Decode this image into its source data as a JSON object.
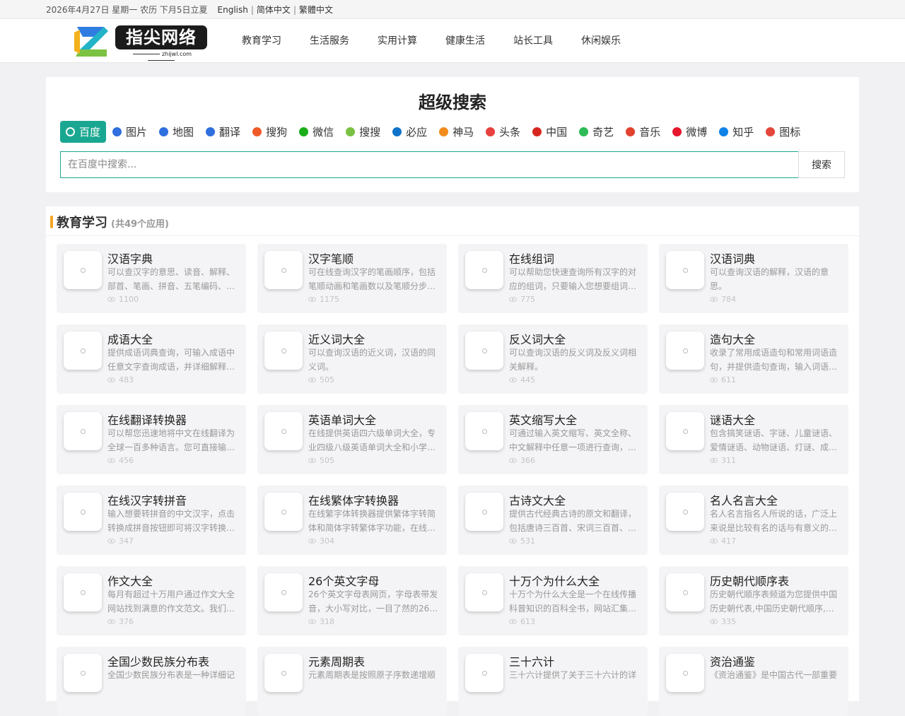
{
  "topbar": {
    "date": "2026年4月27日 星期一 农历 下月5日立夏",
    "langs": [
      "English",
      "简体中文",
      "繁體中文"
    ]
  },
  "logo": {
    "text": "指尖网络",
    "domain": "zhijwl.com"
  },
  "nav": [
    "教育学习",
    "生活服务",
    "实用计算",
    "健康生活",
    "站长工具",
    "休闲娱乐"
  ],
  "search": {
    "title": "超级搜索",
    "placeholder": "在百度中搜索...",
    "button": "搜索",
    "engines": [
      {
        "label": "百度",
        "icon": "baidu-paw-icon",
        "color": "#ffffff"
      },
      {
        "label": "图片",
        "icon": "baidu-paw-icon",
        "color": "#2f6fde"
      },
      {
        "label": "地图",
        "icon": "baidu-paw-icon",
        "color": "#2f6fde"
      },
      {
        "label": "翻译",
        "icon": "baidu-paw-icon",
        "color": "#2f6fde"
      },
      {
        "label": "搜狗",
        "icon": "sogou-icon",
        "color": "#f05a28"
      },
      {
        "label": "微信",
        "icon": "wechat-icon",
        "color": "#1aad19"
      },
      {
        "label": "搜搜",
        "icon": "soso-icon",
        "color": "#7ac143"
      },
      {
        "label": "必应",
        "icon": "bing-icon",
        "color": "#0f74c9"
      },
      {
        "label": "神马",
        "icon": "shenma-icon",
        "color": "#f28c1f"
      },
      {
        "label": "头条",
        "icon": "toutiao-icon",
        "color": "#e8403e"
      },
      {
        "label": "中国",
        "icon": "china-icon",
        "color": "#d7261d"
      },
      {
        "label": "奇艺",
        "icon": "iqiyi-icon",
        "color": "#2dbb55"
      },
      {
        "label": "音乐",
        "icon": "music-icon",
        "color": "#e2412d"
      },
      {
        "label": "微博",
        "icon": "weibo-icon",
        "color": "#e6162d"
      },
      {
        "label": "知乎",
        "icon": "zhihu-icon",
        "color": "#0e82e6"
      },
      {
        "label": "图标",
        "icon": "iconfont-icon",
        "color": "#e4463b"
      }
    ],
    "active_index": 0
  },
  "section": {
    "title": "教育学习",
    "count": "(共49个应用)",
    "cards": [
      {
        "title": "汉语字典",
        "desc": "可以查汉字的意思、读音、解释、部首、笔画、拼音、五笔编码、…",
        "views": "1100"
      },
      {
        "title": "汉字笔顺",
        "desc": "可在线查询汉字的笔画顺序，包括笔顺动画和笔画数以及笔顺分步…",
        "views": "1175"
      },
      {
        "title": "在线组词",
        "desc": "可以帮助您快速查询所有汉字的对应的组词，只要输入您想要组词…",
        "views": "775"
      },
      {
        "title": "汉语词典",
        "desc": "可以查询汉语的解释，汉语的意思。",
        "views": "784"
      },
      {
        "title": "成语大全",
        "desc": "提供成语词典查询，可输入成语中任意文字查询成语，并详细解释…",
        "views": "483"
      },
      {
        "title": "近义词大全",
        "desc": "可以查询汉语的近义词，汉语的同义词。",
        "views": "505"
      },
      {
        "title": "反义词大全",
        "desc": "可以查询汉语的反义词及反义词相关解释。",
        "views": "445"
      },
      {
        "title": "造句大全",
        "desc": "收录了常用成语造句和常用词语造句，并提供造句查询，输入词语…",
        "views": "611"
      },
      {
        "title": "在线翻译转换器",
        "desc": "可以帮您迅速地将中文在线翻译为全球一百多种语言。您可直接输…",
        "views": "456"
      },
      {
        "title": "英语单词大全",
        "desc": "在线提供英语四六级单词大全，专业四级八级英语单词大全和小学…",
        "views": "505"
      },
      {
        "title": "英文缩写大全",
        "desc": "可通过输入英文缩写、英文全称、中文解释中任意一项进行查询，…",
        "views": "366"
      },
      {
        "title": "谜语大全",
        "desc": "包含搞笑谜语、字谜、儿童谜语、爱情谜语、动物谜语、灯谜、成…",
        "views": "311"
      },
      {
        "title": "在线汉字转拼音",
        "desc": "输入想要转拼音的中文汉字，点击转换成拼音按钮即可将汉字转换…",
        "views": "347"
      },
      {
        "title": "在线繁体字转换器",
        "desc": "在线繁字体转换器提供繁体字转简体和简体字转繁体字功能，在线…",
        "views": "304"
      },
      {
        "title": "古诗文大全",
        "desc": "提供古代经典古诗的原文和翻译，包括唐诗三百首、宋词三百首、…",
        "views": "531"
      },
      {
        "title": "名人名言大全",
        "desc": "名人名言指名人所说的话，广泛上来说是比较有名的话与有意义的…",
        "views": "417"
      },
      {
        "title": "作文大全",
        "desc": "每月有超过十万用户通过作文大全网站找到满意的作文范文。我们…",
        "views": "376"
      },
      {
        "title": "26个英文字母",
        "desc": "26个英文字母表网页，字母表带发音，大小写对比，一目了然的26…",
        "views": "318"
      },
      {
        "title": "十万个为什么大全",
        "desc": "十万个为什么大全是一个在线传播科普知识的百科全书，网站汇集…",
        "views": "613"
      },
      {
        "title": "历史朝代顺序表",
        "desc": "历史朝代顺序表频道为您提供中国历史朝代表,中国历史朝代顺序,…",
        "views": "335"
      },
      {
        "title": "全国少数民族分布表",
        "desc": "全国少数民族分布表是一种详细记",
        "views": ""
      },
      {
        "title": "元素周期表",
        "desc": "元素周期表是按照原子序数递增顺",
        "views": ""
      },
      {
        "title": "三十六计",
        "desc": "三十六计提供了关于三十六计的详",
        "views": ""
      },
      {
        "title": "资治通鉴",
        "desc": "《资治通鉴》是中国古代一部重要",
        "views": ""
      }
    ]
  }
}
